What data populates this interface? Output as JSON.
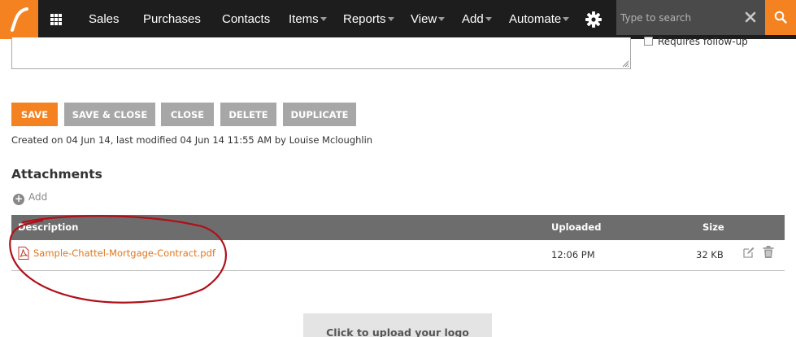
{
  "nav": {
    "items": [
      {
        "label": "Sales",
        "dropdown": false
      },
      {
        "label": "Purchases",
        "dropdown": false
      },
      {
        "label": "Contacts",
        "dropdown": false
      },
      {
        "label": "Items",
        "dropdown": true
      },
      {
        "label": "Reports",
        "dropdown": true
      },
      {
        "label": "View",
        "dropdown": true
      },
      {
        "label": "Add",
        "dropdown": true
      },
      {
        "label": "Automate",
        "dropdown": true
      }
    ],
    "icons": [
      "logo-icon",
      "apps-grid-icon",
      "gear-icon",
      "clear-search-icon",
      "search-icon"
    ],
    "search_placeholder": "Type to search"
  },
  "colors": {
    "brand": "#f58220",
    "nav_bg": "#1d1d1d",
    "secondary_button": "#a7a7a7",
    "table_header": "#6d6d6d",
    "link": "#e0761c",
    "annotation": "#b0101a"
  },
  "form": {
    "followup_label": "Requires follow-up",
    "followup_checked": false
  },
  "actions": {
    "save": "Save",
    "save_close": "Save & Close",
    "close": "Close",
    "delete": "Delete",
    "duplicate": "Duplicate"
  },
  "meta": "Created on 04 Jun 14, last modified 04 Jun 14 11:55 AM by Louise Mcloughlin",
  "attachments": {
    "title": "Attachments",
    "add_label": "Add",
    "columns": {
      "description": "Description",
      "uploaded": "Uploaded",
      "size": "Size"
    },
    "rows": [
      {
        "file": "Sample-Chattel-Mortgage-Contract.pdf",
        "uploaded": "12:06 PM",
        "size": "32 KB"
      }
    ]
  },
  "upload_logo": "Click to upload your logo"
}
